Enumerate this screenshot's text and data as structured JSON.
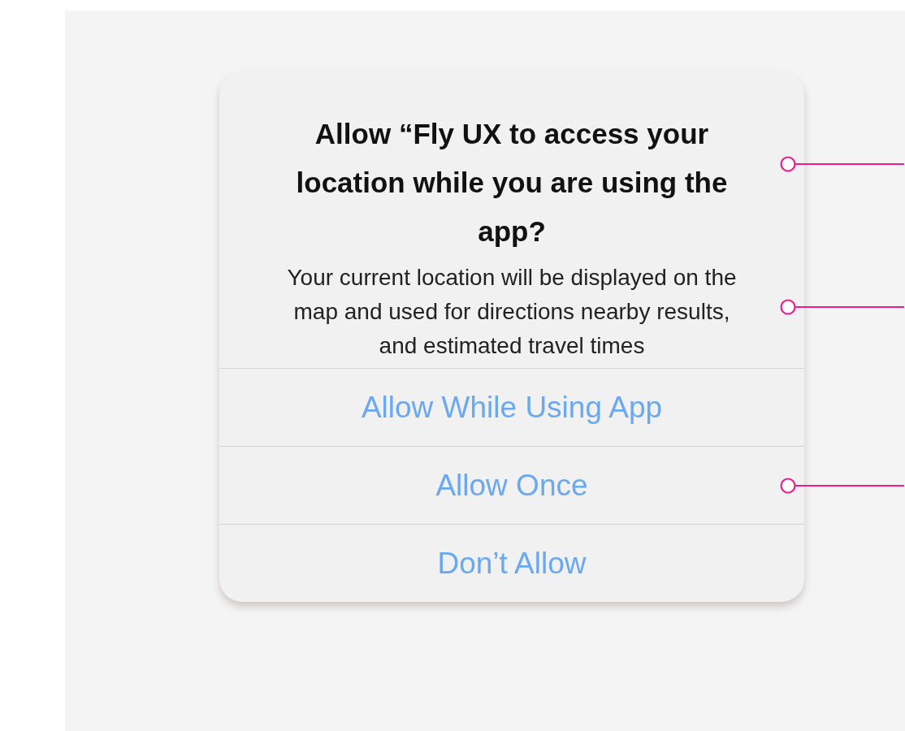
{
  "dialog": {
    "title": "Allow “Fly UX to access your location while you are using the app?",
    "title_callout": true,
    "message": "Your current location will be displayed on the map and used for directions nearby results, and estimated travel times",
    "message_callout": true,
    "buttons": [
      {
        "label": "Allow While Using App",
        "callout": false
      },
      {
        "label": "Allow Once",
        "callout": true
      },
      {
        "label": "Don’t Allow",
        "callout": false
      }
    ]
  }
}
